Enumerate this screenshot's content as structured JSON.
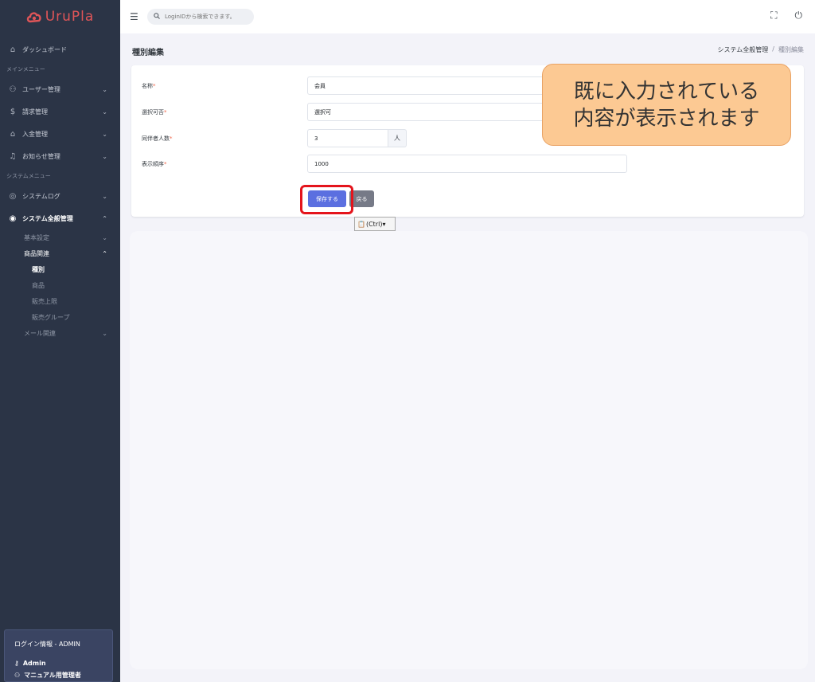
{
  "brand": {
    "logo_text": "UruPla",
    "accent": "#e05558"
  },
  "topbar": {
    "search_placeholder": "LoginIDから検索できます。",
    "icons": [
      "menu-icon",
      "search-icon",
      "fullscreen-icon",
      "power-icon"
    ]
  },
  "sidebar": {
    "items": [
      {
        "label": "ダッシュボード",
        "icon": "home-icon"
      }
    ],
    "section_main": "メインメニュー",
    "main_items": [
      {
        "label": "ユーザー管理",
        "icon": "user-icon"
      },
      {
        "label": "請求管理",
        "icon": "dollar-icon"
      },
      {
        "label": "入金管理",
        "icon": "bank-icon"
      },
      {
        "label": "お知らせ管理",
        "icon": "bell-icon"
      }
    ],
    "section_system": "システムメニュー",
    "system_items": [
      {
        "label": "システムログ",
        "icon": "globe-icon"
      },
      {
        "label": "システム全般管理",
        "icon": "globe-icon"
      }
    ],
    "sub_items": {
      "basic": "基本設定",
      "products": "商品関連",
      "products_children": [
        "種別",
        "商品",
        "販売上限",
        "販売グループ"
      ],
      "mail": "メール関連"
    }
  },
  "login_info": {
    "title": "ログイン情報 - ADMIN",
    "user": "Admin",
    "role": "マニュアル用管理者"
  },
  "page": {
    "title": "種別編集",
    "breadcrumb": [
      "システム全般管理",
      "種別編集"
    ]
  },
  "form": {
    "name_label": "名称",
    "name_value": "会員",
    "selectable_label": "選択可否",
    "selectable_value": "選択可",
    "companions_label": "同伴者人数",
    "companions_value": "3",
    "companions_unit": "人",
    "order_label": "表示順序",
    "order_value": "1000",
    "required_mark": "*",
    "save_label": "保存する",
    "back_label": "戻る"
  },
  "paste_widget": {
    "label": "(Ctrl)▾"
  },
  "callout": {
    "line1": "既に入力されている",
    "line2": "内容が表示されます"
  }
}
